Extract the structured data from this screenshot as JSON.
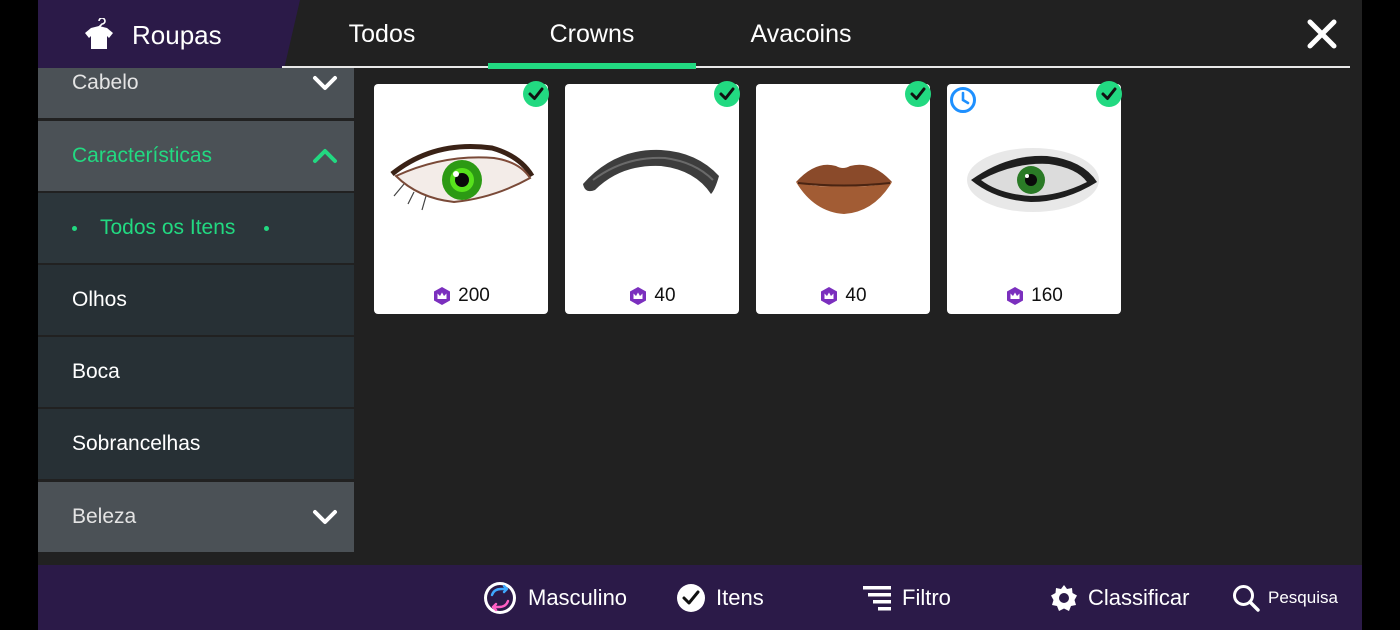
{
  "header": {
    "title": "Roupas",
    "tabs": [
      {
        "label": "Todos"
      },
      {
        "label": "Crowns"
      },
      {
        "label": "Avacoins"
      }
    ],
    "active_tab": "Crowns"
  },
  "sidebar": {
    "items": [
      {
        "label": "Cabelo",
        "type": "category",
        "expanded": false
      },
      {
        "label": "Características",
        "type": "category",
        "expanded": true
      },
      {
        "label": "Todos os Itens",
        "type": "subcategory",
        "selected": true
      },
      {
        "label": "Olhos",
        "type": "subcategory"
      },
      {
        "label": "Boca",
        "type": "subcategory"
      },
      {
        "label": "Sobrancelhas",
        "type": "subcategory"
      },
      {
        "label": "Beleza",
        "type": "category",
        "expanded": false
      }
    ]
  },
  "items": [
    {
      "name": "green-eye",
      "price": "200",
      "currency_icon": "crown-icon",
      "owned": true,
      "limited": false
    },
    {
      "name": "eyebrow",
      "price": "40",
      "currency_icon": "crown-icon",
      "owned": true,
      "limited": false
    },
    {
      "name": "lips",
      "price": "40",
      "currency_icon": "crown-icon",
      "owned": true,
      "limited": false
    },
    {
      "name": "smoky-green-eye",
      "price": "160",
      "currency_icon": "crown-icon",
      "owned": true,
      "limited": true
    }
  ],
  "bottom_bar": {
    "masculino": "Masculino",
    "itens": "Itens",
    "filtro": "Filtro",
    "classificar": "Classificar",
    "pesquisa": "Pesquisa"
  },
  "colors": {
    "accent": "#22d981",
    "header_purple": "#2b1a48",
    "panel_bg": "#212121",
    "crown_purple": "#7b2fbe",
    "clock_blue": "#1e90ff"
  }
}
